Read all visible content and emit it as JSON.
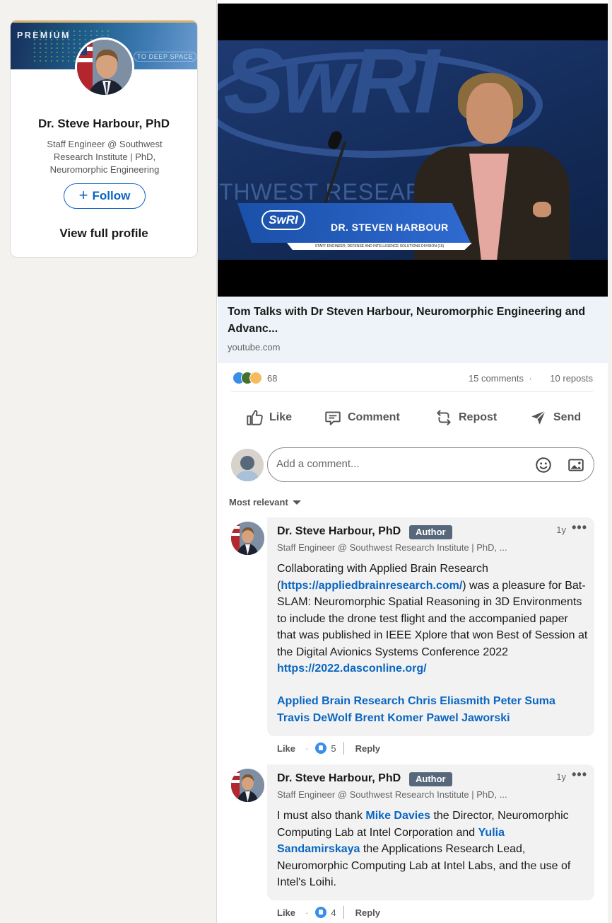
{
  "profile_card": {
    "banner_label": "PREMIUM",
    "banner_tag": "TO DEEP SPACE",
    "name": "Dr. Steve Harbour, PhD",
    "headline": "Staff Engineer @ Southwest Research Institute | PhD, Neuromorphic Engineering",
    "follow_label": "Follow",
    "view_profile_label": "View full profile"
  },
  "video": {
    "backdrop_logo": "SwRI",
    "backdrop_text": "THWEST RESEARCH",
    "lower_third_logo": "SwRI",
    "lower_third_name": "DR. STEVEN HARBOUR",
    "lower_third_subtitle": "STAFF ENGINEER, DEFENSE AND INTELLIGENCE SOLUTIONS DIVISION (16)"
  },
  "link_preview": {
    "title": "Tom Talks with Dr Steven Harbour, Neuromorphic Engineering and Advanc...",
    "domain": "youtube.com"
  },
  "social": {
    "reaction_count": "68",
    "comments": "15 comments",
    "separator": "·",
    "reposts": "10 reposts"
  },
  "actions": {
    "like": "Like",
    "comment": "Comment",
    "repost": "Repost",
    "send": "Send"
  },
  "comment_input": {
    "placeholder": "Add a comment..."
  },
  "sort": {
    "label": "Most relevant"
  },
  "comments": [
    {
      "name": "Dr. Steve Harbour, PhD",
      "badge": "Author",
      "time": "1y",
      "more": "•••",
      "headline": "Staff Engineer @ Southwest Research Institute | PhD, ...",
      "text_1": "Collaborating with Applied Brain Research (",
      "link_1": "https://appliedbrainresearch.com/",
      "text_2": ") was a pleasure for Bat-SLAM: Neuromorphic Spatial Reasoning in 3D Environments to include the drone test flight and the accompanied paper that was published in IEEE Xplore that won Best of Session at the Digital Avionics Systems Conference 2022 ",
      "link_2": "https://2022.dasconline.org/",
      "mentions": [
        "Applied Brain Research",
        "Chris Eliasmith",
        "Peter Suma",
        "Travis DeWolf",
        "Brent Komer",
        "Pawel Jaworski"
      ],
      "like_label": "Like",
      "dot": "·",
      "like_count": "5",
      "reply_label": "Reply"
    },
    {
      "name": "Dr. Steve Harbour, PhD",
      "badge": "Author",
      "time": "1y",
      "more": "•••",
      "headline": "Staff Engineer @ Southwest Research Institute | PhD, ...",
      "text_1": "I must also thank ",
      "mention_1": "Mike Davies",
      "text_2": " the Director, Neuromorphic Computing Lab at Intel Corporation and ",
      "mention_2": "Yulia Sandamirskaya",
      "text_3": " the Applications Research Lead, Neuromorphic Computing Lab at Intel Labs, and the use of Intel's Loihi.",
      "like_label": "Like",
      "dot": "·",
      "like_count": "4",
      "reply_label": "Reply"
    }
  ],
  "colors": {
    "accent": "#0a66c2",
    "badge": "#56687a",
    "page_bg": "#f4f2ee"
  },
  "icons": [
    "plus-icon",
    "like-icon",
    "comment-icon",
    "repost-icon",
    "send-icon",
    "emoji-icon",
    "image-icon",
    "caret-down-icon",
    "more-icon"
  ]
}
